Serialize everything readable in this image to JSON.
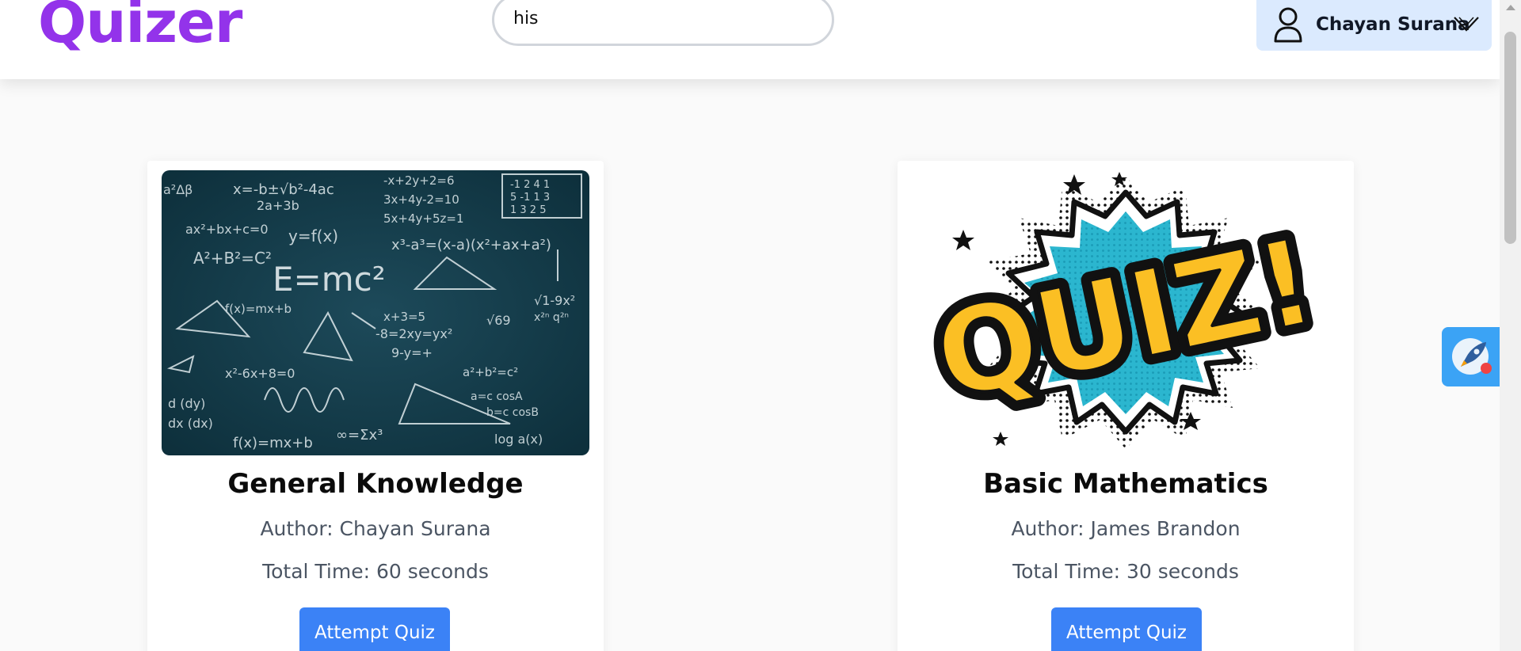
{
  "header": {
    "logo": "Quizer",
    "search_value": "his",
    "user_name": "Chayan Surana"
  },
  "colors": {
    "brand": "#9333ea",
    "button": "#3b82f6",
    "user_bg": "#dbeafe"
  },
  "quizzes": [
    {
      "title": "General Knowledge",
      "author": "Author: Chayan Surana",
      "time": "Total Time: 60 seconds",
      "button": "Attempt Quiz",
      "image": "chalkboard-equations-image"
    },
    {
      "title": "Basic Mathematics",
      "author": "Author: James Brandon",
      "time": "Total Time: 30 seconds",
      "button": "Attempt Quiz",
      "image": "quiz-comic-burst-image"
    }
  ],
  "icons": {
    "user": "user-icon",
    "dropdown": "chevron-down-icon",
    "floating": "rocket-icon"
  }
}
